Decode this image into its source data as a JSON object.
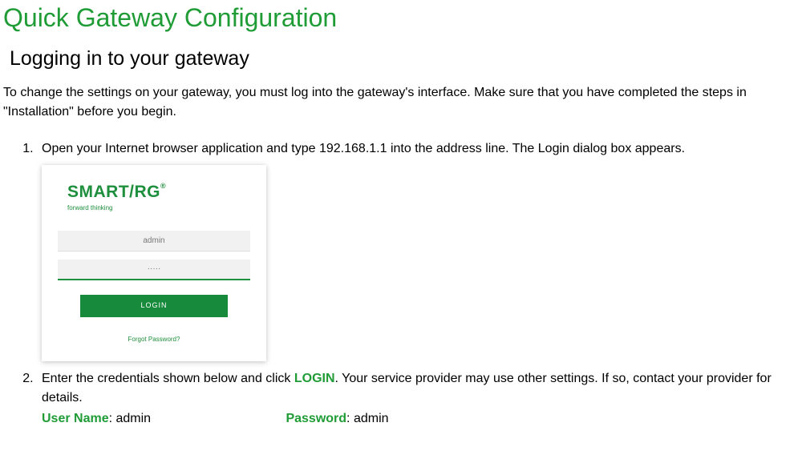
{
  "title": "Quick Gateway Configuration",
  "section": "Logging in to your gateway",
  "intro": "To change the settings on your gateway, you must log into the gateway's interface. Make sure that you have completed the steps in \"Installation\" before you begin.",
  "steps": {
    "s1": "Open your Internet browser application and type 192.168.1.1 into the address line. The Login dialog box appears.",
    "s2_part1": "Enter the credentials shown below and click ",
    "s2_login_word": "LOGIN",
    "s2_part2": ". Your service provider may use other settings. If so, contact your provider for details.",
    "cred_user_label": "User Name",
    "cred_user_value": ": admin",
    "cred_pass_label": "Password",
    "cred_pass_value": ": admin"
  },
  "login_box": {
    "brand1": "SMART",
    "brand2": "/RG",
    "reg": "®",
    "tagline": "forward thinking",
    "username_value": "admin",
    "password_masked": "·····",
    "login_button": "LOGIN",
    "forgot": "Forgot Password?"
  }
}
